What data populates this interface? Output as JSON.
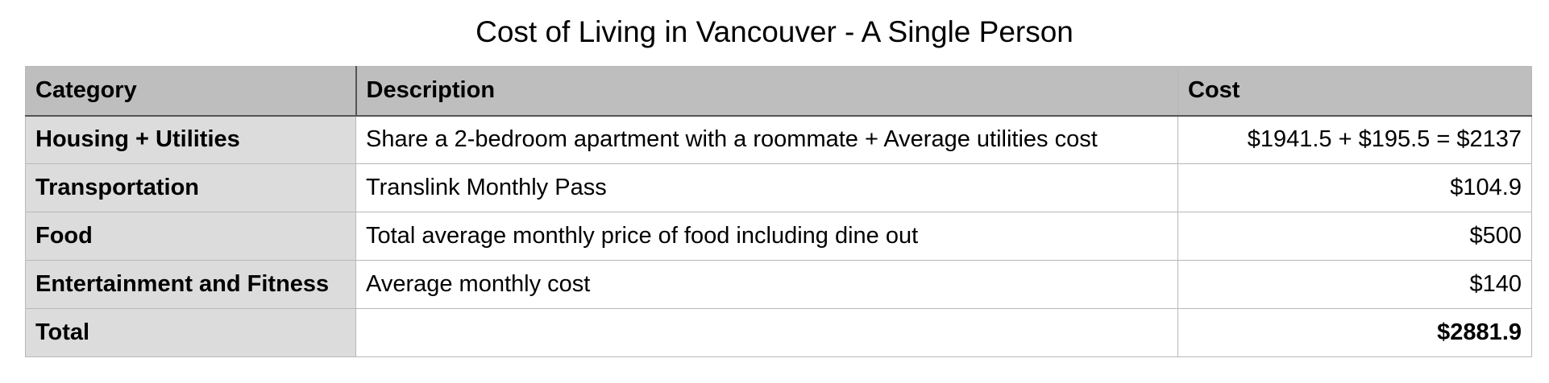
{
  "title": "Cost of Living in Vancouver - A Single Person",
  "table": {
    "headers": [
      "Category",
      "Description",
      "Cost"
    ],
    "rows": [
      {
        "category": "Housing + Utilities",
        "description": "Share a 2-bedroom apartment with a roommate + Average utilities cost",
        "cost": "$1941.5 + $195.5 = $2137"
      },
      {
        "category": "Transportation",
        "description": "Translink Monthly Pass",
        "cost": "$104.9"
      },
      {
        "category": "Food",
        "description": "Total average monthly price of food including dine out",
        "cost": "$500"
      },
      {
        "category": "Entertainment and Fitness",
        "description": "Average monthly cost",
        "cost": "$140"
      },
      {
        "category": "Total",
        "description": "",
        "cost": "$2881.9"
      }
    ]
  },
  "colors": {
    "header_bg": "#bdbebd",
    "category_bg": "#dcdcdc",
    "grid": "#b8b8b8",
    "divider": "#555555"
  }
}
